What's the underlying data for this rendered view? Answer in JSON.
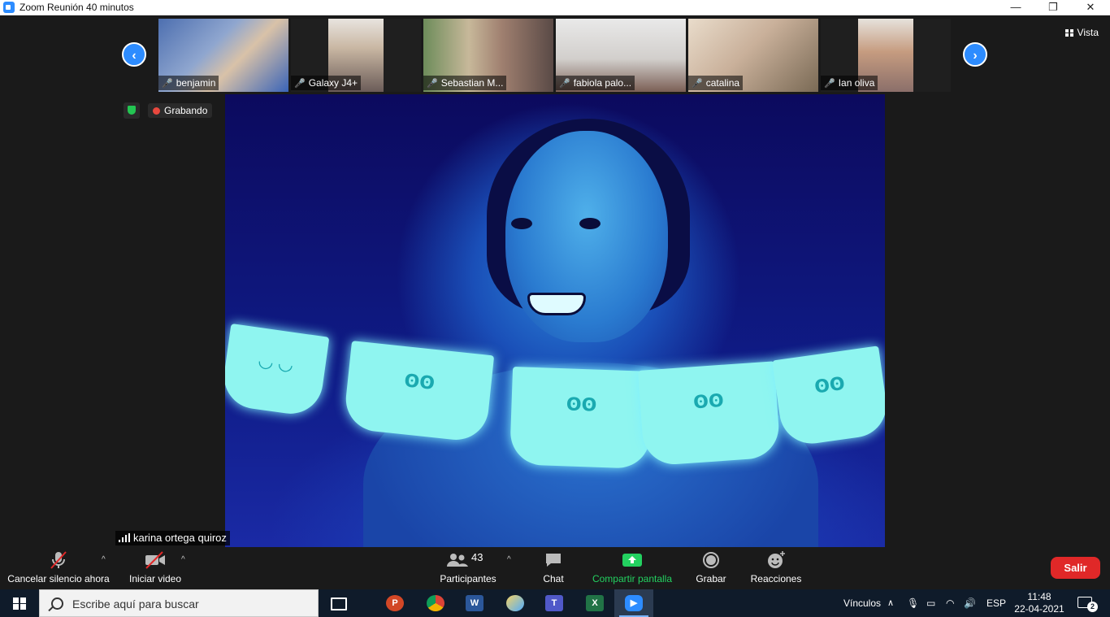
{
  "window": {
    "title": "Zoom Reunión 40 minutos",
    "minimize": "—",
    "restore": "❐",
    "close": "✕"
  },
  "gallery": {
    "prev": "‹",
    "next": "›",
    "view_label": "Vista",
    "participants": [
      {
        "name": "benjamin",
        "muted": true
      },
      {
        "name": "Galaxy J4+",
        "muted": true
      },
      {
        "name": "Sebastian M...",
        "muted": true
      },
      {
        "name": "fabiola palo...",
        "muted": true
      },
      {
        "name": "catalina",
        "muted": true
      },
      {
        "name": "Ian oliva",
        "muted": true
      }
    ]
  },
  "status": {
    "recording_label": "Grabando"
  },
  "main_video": {
    "speaker_name": "karina ortega quiroz"
  },
  "toolbar": {
    "mute_label": "Cancelar silencio ahora",
    "video_label": "Iniciar video",
    "participants_label": "Participantes",
    "participants_count": "43",
    "chat_label": "Chat",
    "share_label": "Compartir pantalla",
    "record_label": "Grabar",
    "reactions_label": "Reacciones",
    "leave_label": "Salir",
    "caret": "^",
    "accent_green": "#23d160",
    "leave_red": "#e02828"
  },
  "taskbar": {
    "search_placeholder": "Escribe aquí para buscar",
    "links_label": "Vínculos",
    "language": "ESP",
    "time": "11:48",
    "date": "22-04-2021",
    "notifications": "2",
    "apps": [
      "task-view-icon",
      "powerpoint-icon",
      "chrome-icon",
      "word-icon",
      "paint-icon",
      "teams-icon",
      "excel-icon",
      "zoom-icon"
    ]
  }
}
